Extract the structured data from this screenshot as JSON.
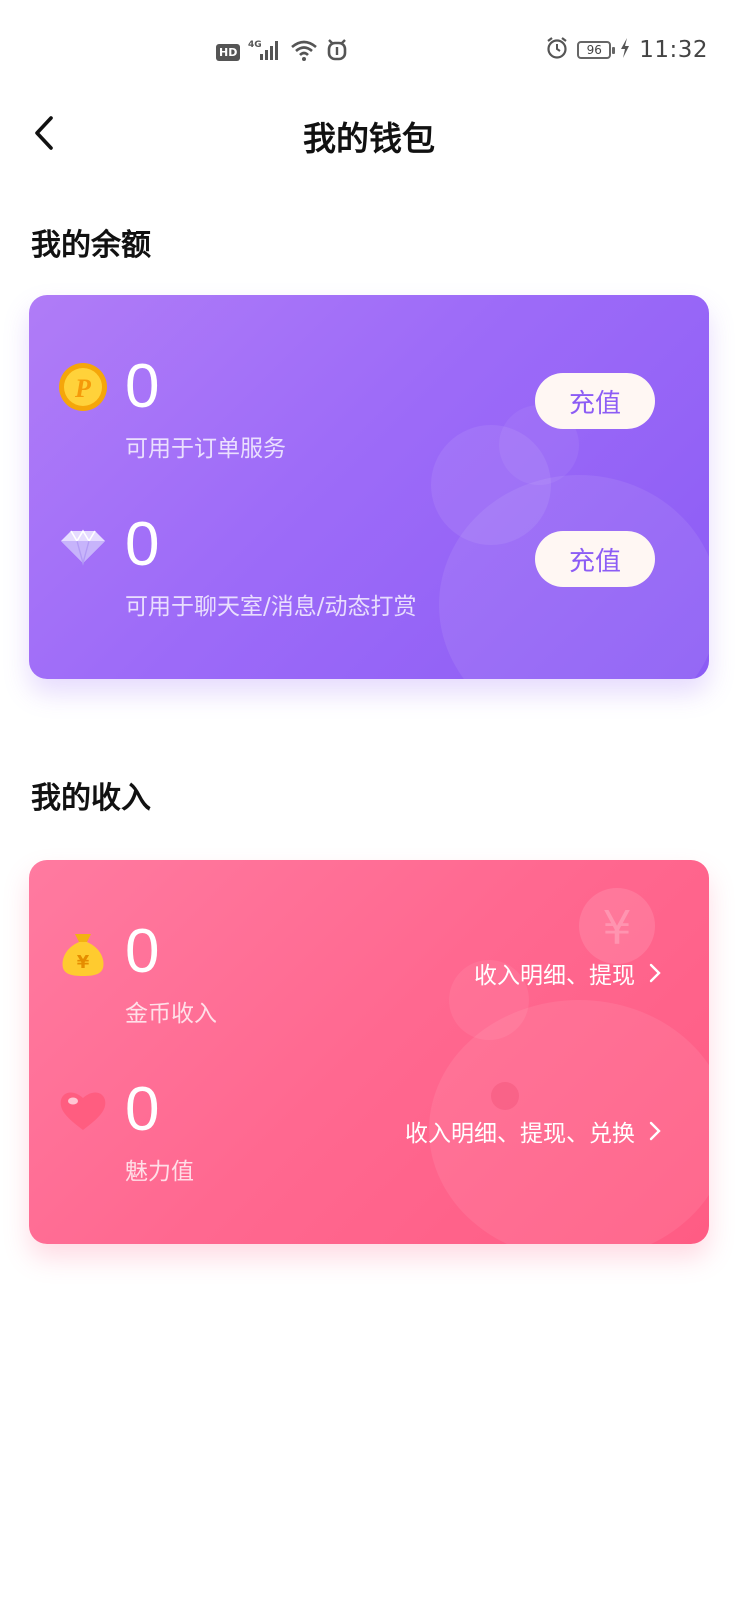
{
  "status_bar": {
    "hd": "HD",
    "network": "4G",
    "battery": "96",
    "time": "11:32"
  },
  "header": {
    "title": "我的钱包",
    "back_icon": "chevron-left-icon"
  },
  "balance": {
    "heading": "我的余额",
    "items": [
      {
        "icon": "coin-p-icon",
        "value": "0",
        "desc": "可用于订单服务",
        "button": "充值"
      },
      {
        "icon": "diamond-icon",
        "value": "0",
        "desc": "可用于聊天室/消息/动态打赏",
        "button": "充值"
      }
    ],
    "colors": {
      "start": "#b07cf7",
      "end": "#8c5cf5"
    }
  },
  "income": {
    "heading": "我的收入",
    "items": [
      {
        "icon": "money-bag-icon",
        "value": "0",
        "desc": "金币收入",
        "link": "收入明细、提现"
      },
      {
        "icon": "heart-icon",
        "value": "0",
        "desc": "魅力值",
        "link": "收入明细、提现、兑换"
      }
    ],
    "colors": {
      "start": "#ff7aa0",
      "end": "#ff5c84"
    }
  }
}
